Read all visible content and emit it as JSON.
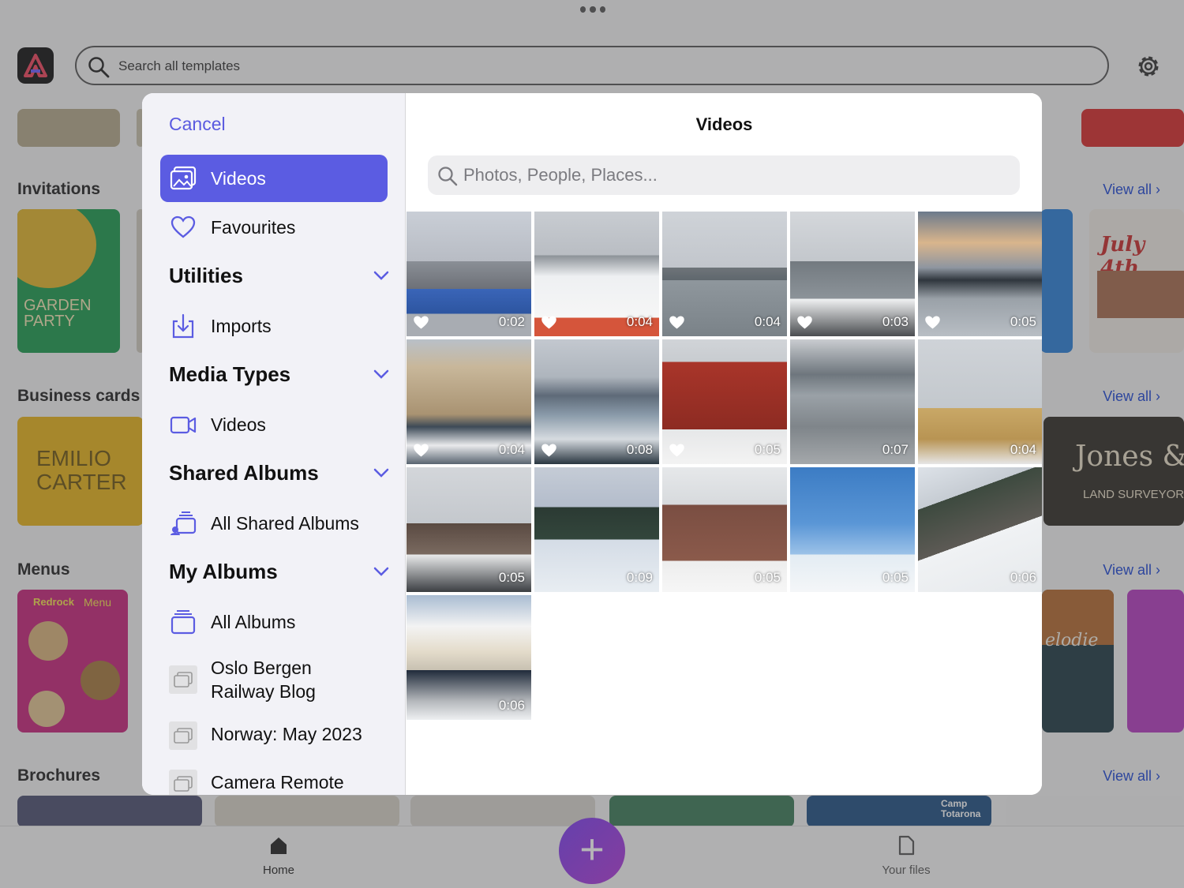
{
  "app": {
    "search_placeholder": "Search all templates",
    "sections": [
      {
        "title": "Invitations",
        "view_all": "View all"
      },
      {
        "title": "Business cards",
        "view_all": "View all"
      },
      {
        "title": "Menus",
        "view_all": "View all"
      },
      {
        "title": "Brochures",
        "view_all": "View all"
      }
    ],
    "cards": {
      "garden": "GARDEN PARTY",
      "july": "July 4th",
      "emilio": "EMILIO CARTER",
      "jones": "Jones & Son",
      "land": "LAND SURVEYOR",
      "redrock": "Redrock",
      "menu": "Menu",
      "melodie": "elodie",
      "camp": "Camp Totarona"
    },
    "nav": {
      "home": "Home",
      "files": "Your files",
      "fab": "+"
    }
  },
  "picker": {
    "cancel": "Cancel",
    "title": "Videos",
    "search_placeholder": "Photos, People, Places...",
    "sidebar": {
      "videos_active": "Videos",
      "favourites": "Favourites",
      "utilities": "Utilities",
      "imports": "Imports",
      "media_types": "Media Types",
      "videos": "Videos",
      "shared_albums": "Shared Albums",
      "all_shared_albums": "All Shared Albums",
      "my_albums": "My Albums",
      "all_albums": "All Albums",
      "albums": [
        "Oslo Bergen Railway Blog",
        "Norway: May 2023",
        "Camera Remote"
      ]
    },
    "videos": [
      {
        "duration": "0:02",
        "favourite": true,
        "scene": "tram"
      },
      {
        "duration": "0:04",
        "favourite": true,
        "scene": "ferry-deck"
      },
      {
        "duration": "0:04",
        "favourite": true,
        "scene": "grey-sea"
      },
      {
        "duration": "0:03",
        "favourite": true,
        "scene": "railing"
      },
      {
        "duration": "0:05",
        "favourite": true,
        "scene": "sunset-pier"
      },
      {
        "duration": "0:04",
        "favourite": true,
        "scene": "grand-hotel"
      },
      {
        "duration": "0:08",
        "favourite": true,
        "scene": "old-town"
      },
      {
        "duration": "0:05",
        "favourite": true,
        "scene": "red-house"
      },
      {
        "duration": "0:07",
        "favourite": false,
        "scene": "rocky-shore"
      },
      {
        "duration": "0:04",
        "favourite": false,
        "scene": "yellow-houses"
      },
      {
        "duration": "0:05",
        "favourite": false,
        "scene": "ferris-wheel"
      },
      {
        "duration": "0:09",
        "favourite": false,
        "scene": "frozen-lake"
      },
      {
        "duration": "0:05",
        "favourite": false,
        "scene": "factory"
      },
      {
        "duration": "0:05",
        "favourite": false,
        "scene": "blue-sky"
      },
      {
        "duration": "0:06",
        "favourite": false,
        "scene": "snowy-cliff"
      },
      {
        "duration": "0:06",
        "favourite": false,
        "scene": "photographer"
      }
    ]
  }
}
